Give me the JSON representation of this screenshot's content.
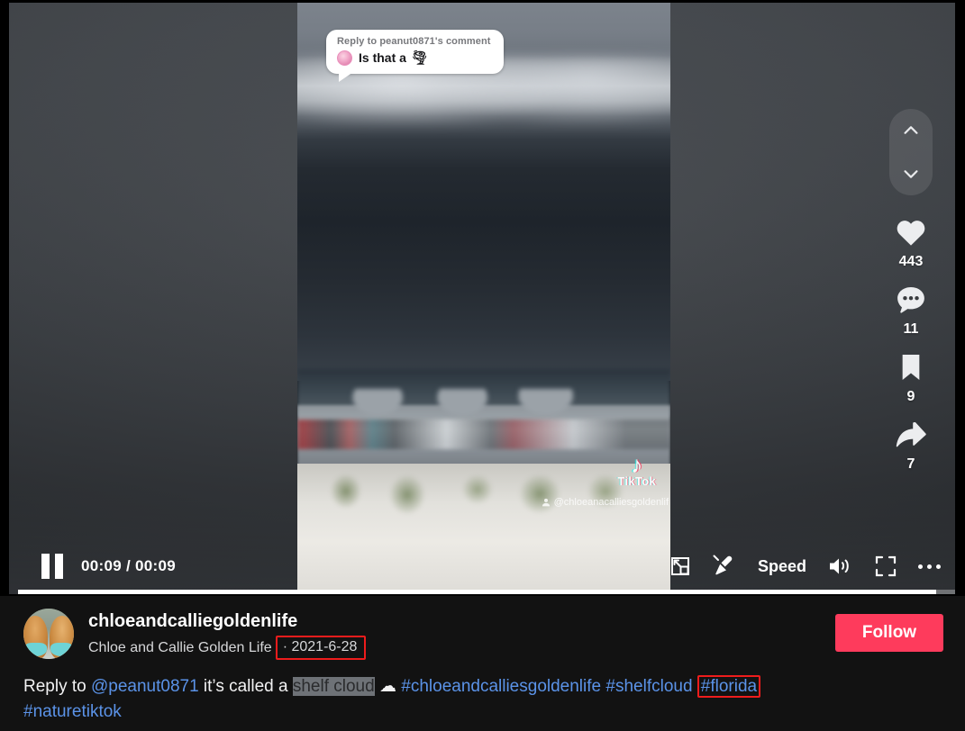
{
  "player": {
    "reply_sticker": {
      "header": "Reply to peanut0871's comment",
      "text": "Is that a",
      "emoji": "🌪"
    },
    "watermark": {
      "brand": "TikTok",
      "note_icon": "♪",
      "username": "@chloeanacalliesgoldenlif"
    },
    "progress_percent": 97
  },
  "rail": {
    "prev_label": "Previous video",
    "next_label": "Next video",
    "actions": [
      {
        "name": "like",
        "icon": "heart-icon",
        "count": "443"
      },
      {
        "name": "comment",
        "icon": "comment-icon",
        "count": "11"
      },
      {
        "name": "bookmark",
        "icon": "bookmark-icon",
        "count": "9"
      },
      {
        "name": "share",
        "icon": "share-icon",
        "count": "7"
      }
    ]
  },
  "controls": {
    "play_state": "paused",
    "current_time": "00:09",
    "duration": "00:09",
    "time_display": "00:09 / 00:09",
    "speed_label": "Speed",
    "pip_label": "Picture in picture",
    "clear_label": "Clear display",
    "volume_label": "Volume",
    "fullscreen_label": "Fullscreen",
    "more_label": "More"
  },
  "meta": {
    "username": "chloeandcalliegoldenlife",
    "display_name": "Chloe and Callie Golden Life",
    "separator": "·",
    "date": "2021-6-28",
    "follow_label": "Follow",
    "caption": {
      "prefix": "Reply to ",
      "mention": "@peanut0871",
      "middle": " it’s called a ",
      "selected": "shelf cloud",
      "emoji": "☁",
      "hashtag1": "#chloeandcalliesgoldenlife",
      "hashtag2": "#shelfcloud",
      "hashtag3": "#florida",
      "hashtag4": "#naturetiktok"
    }
  },
  "colors": {
    "brand_red": "#fe3b5c",
    "highlight_box": "#ee1c1c",
    "link_blue": "#5b93e8",
    "meta_bg": "#121212"
  }
}
